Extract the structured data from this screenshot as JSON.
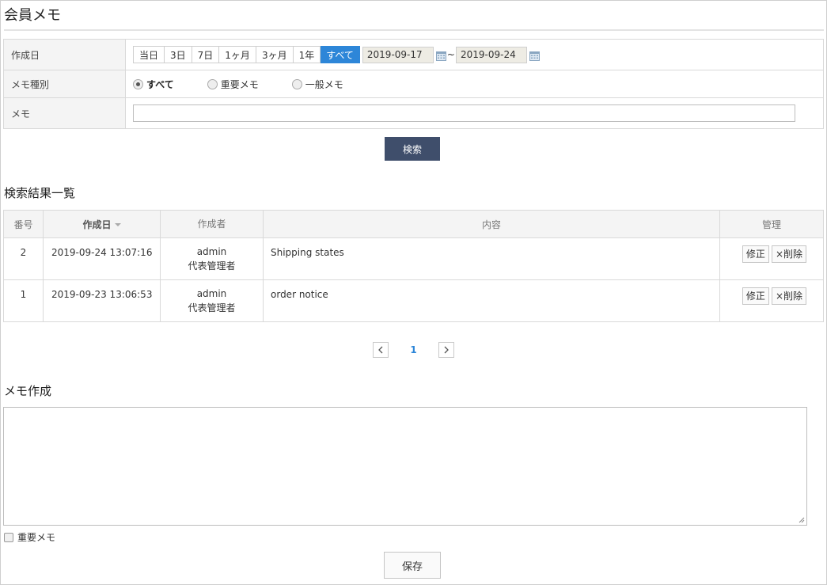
{
  "page": {
    "title": "会員メモ"
  },
  "search": {
    "date_label": "作成日",
    "periods": [
      "当日",
      "3日",
      "7日",
      "1ヶ月",
      "3ヶ月",
      "1年",
      "すべて"
    ],
    "active_period": "すべて",
    "date_from": "2019-09-17",
    "date_to": "2019-09-24",
    "range_sep": "~",
    "type_label": "メモ種別",
    "types": [
      "すべて",
      "重要メモ",
      "一般メモ"
    ],
    "selected_type": "すべて",
    "memo_label": "メモ",
    "memo_value": "",
    "button": "検索"
  },
  "results": {
    "title": "検索結果一覧",
    "columns": [
      "番号",
      "作成日",
      "作成者",
      "内容",
      "管理"
    ],
    "rows": [
      {
        "num": "2",
        "date": "2019-09-24 13:07:16",
        "author": "admin",
        "role": "代表管理者",
        "content": "Shipping states",
        "edit": "修正",
        "delete": "×削除"
      },
      {
        "num": "1",
        "date": "2019-09-23 13:06:53",
        "author": "admin",
        "role": "代表管理者",
        "content": "order notice",
        "edit": "修正",
        "delete": "×削除"
      }
    ]
  },
  "pagination": {
    "current": "1"
  },
  "compose": {
    "title": "メモ作成",
    "text": "",
    "important_label": "重要メモ",
    "important_checked": false,
    "save": "保存"
  },
  "colors": {
    "active": "#2d86d8",
    "search_button": "#3f4e6b"
  }
}
